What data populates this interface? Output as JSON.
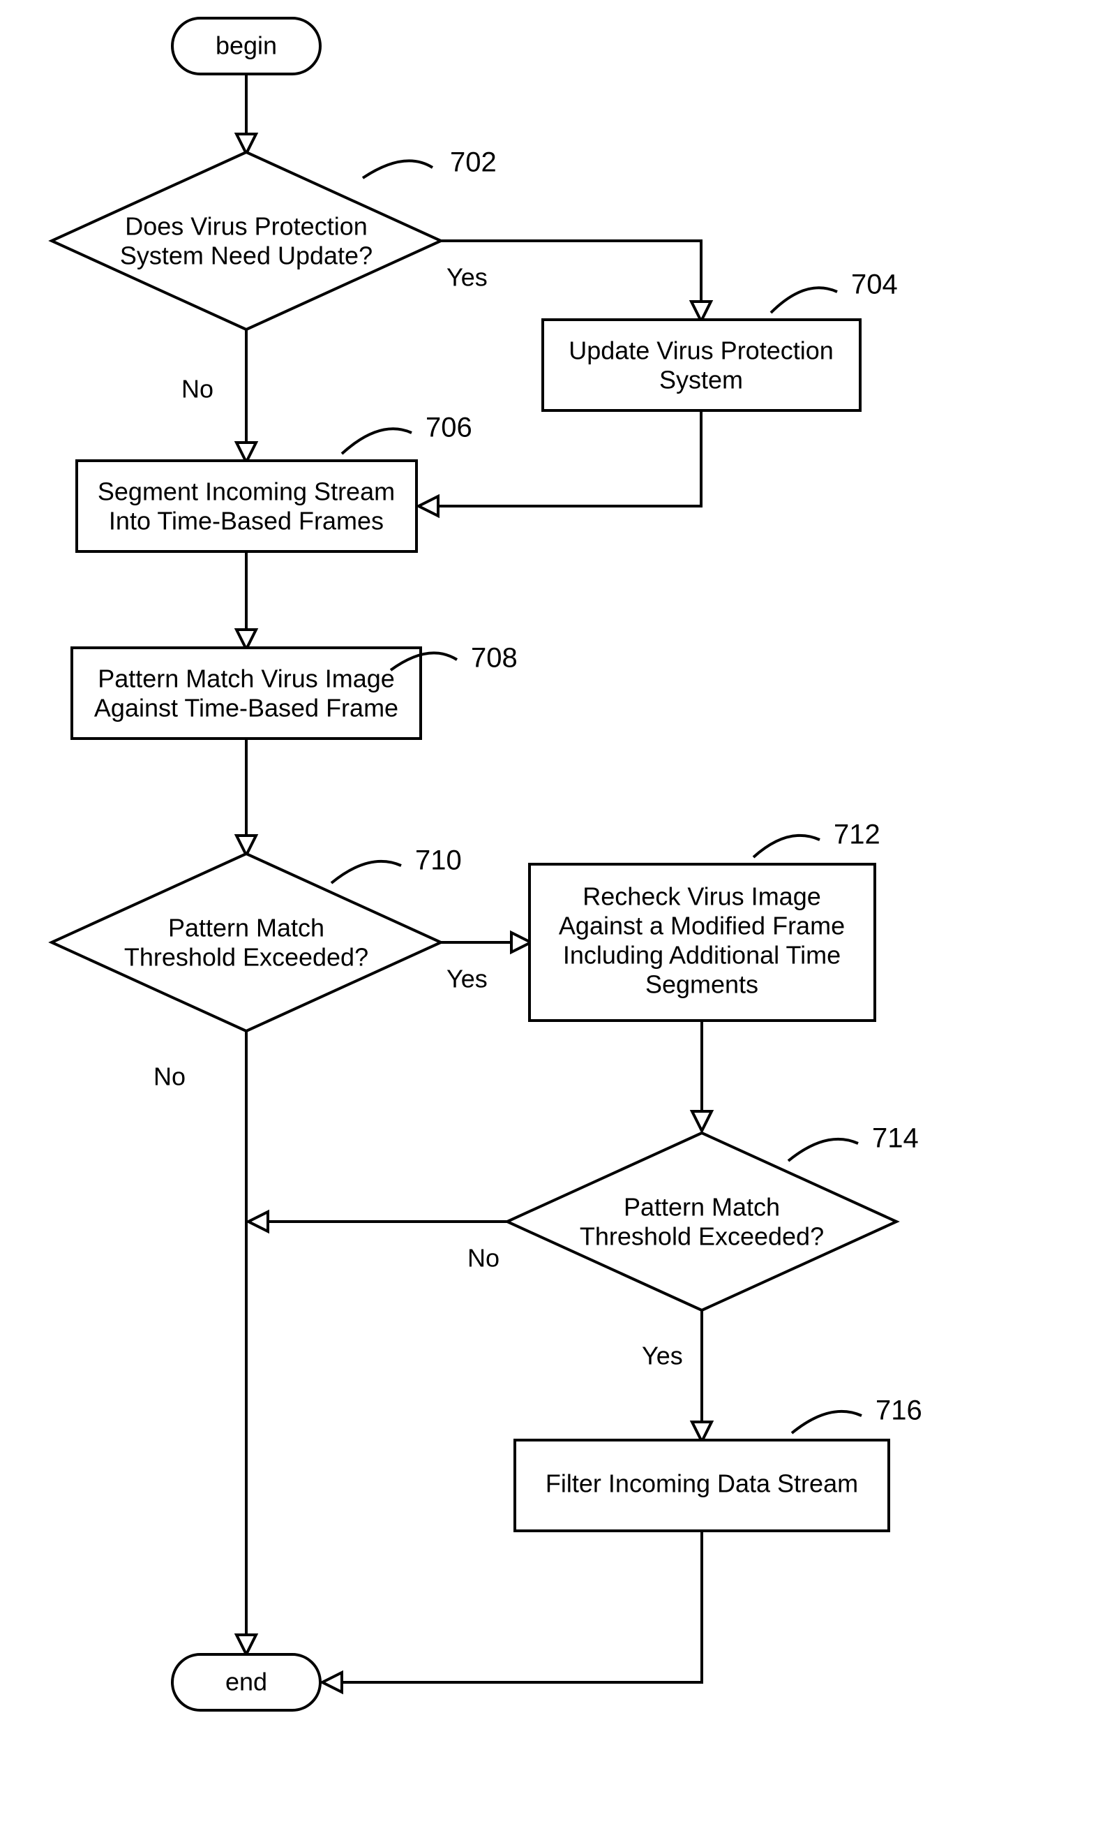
{
  "chart_data": {
    "type": "flowchart",
    "title": "",
    "nodes": [
      {
        "id": "begin",
        "type": "terminator",
        "label": "begin"
      },
      {
        "id": "d702",
        "type": "decision",
        "ref": "702",
        "label": "Does Virus Protection System Need Update?"
      },
      {
        "id": "p704",
        "type": "process",
        "ref": "704",
        "label": "Update Virus Protection System"
      },
      {
        "id": "p706",
        "type": "process",
        "ref": "706",
        "label": "Segment Incoming Stream Into Time-Based Frames"
      },
      {
        "id": "p708",
        "type": "process",
        "ref": "708",
        "label": "Pattern Match Virus Image Against Time-Based Frame"
      },
      {
        "id": "d710",
        "type": "decision",
        "ref": "710",
        "label": "Pattern Match Threshold Exceeded?"
      },
      {
        "id": "p712",
        "type": "process",
        "ref": "712",
        "label": "Recheck Virus Image Against a Modified Frame Including Additional Time Segments"
      },
      {
        "id": "d714",
        "type": "decision",
        "ref": "714",
        "label": "Pattern Match Threshold Exceeded?"
      },
      {
        "id": "p716",
        "type": "process",
        "ref": "716",
        "label": "Filter Incoming Data Stream"
      },
      {
        "id": "end",
        "type": "terminator",
        "label": "end"
      }
    ],
    "edges": [
      {
        "from": "begin",
        "to": "d702"
      },
      {
        "from": "d702",
        "to": "p704",
        "label": "Yes"
      },
      {
        "from": "d702",
        "to": "p706",
        "label": "No"
      },
      {
        "from": "p704",
        "to": "p706"
      },
      {
        "from": "p706",
        "to": "p708"
      },
      {
        "from": "p708",
        "to": "d710"
      },
      {
        "from": "d710",
        "to": "p712",
        "label": "Yes"
      },
      {
        "from": "d710",
        "to": "end",
        "label": "No"
      },
      {
        "from": "p712",
        "to": "d714"
      },
      {
        "from": "d714",
        "to": "end-merge",
        "label": "No"
      },
      {
        "from": "d714",
        "to": "p716",
        "label": "Yes"
      },
      {
        "from": "p716",
        "to": "end"
      }
    ]
  },
  "labels": {
    "yes": "Yes",
    "no": "No"
  },
  "nodes": {
    "begin": "begin",
    "end": "end",
    "d702_l1": "Does Virus Protection",
    "d702_l2": "System Need Update?",
    "p704_l1": "Update Virus Protection",
    "p704_l2": "System",
    "p706_l1": "Segment Incoming Stream",
    "p706_l2": "Into Time-Based Frames",
    "p708_l1": "Pattern Match Virus Image",
    "p708_l2": "Against Time-Based Frame",
    "d710_l1": "Pattern Match",
    "d710_l2": "Threshold Exceeded?",
    "p712_l1": "Recheck Virus Image",
    "p712_l2": "Against a Modified Frame",
    "p712_l3": "Including Additional Time",
    "p712_l4": "Segments",
    "d714_l1": "Pattern Match",
    "d714_l2": "Threshold Exceeded?",
    "p716_l1": "Filter Incoming Data Stream"
  },
  "refs": {
    "r702": "702",
    "r704": "704",
    "r706": "706",
    "r708": "708",
    "r710": "710",
    "r712": "712",
    "r714": "714",
    "r716": "716"
  }
}
